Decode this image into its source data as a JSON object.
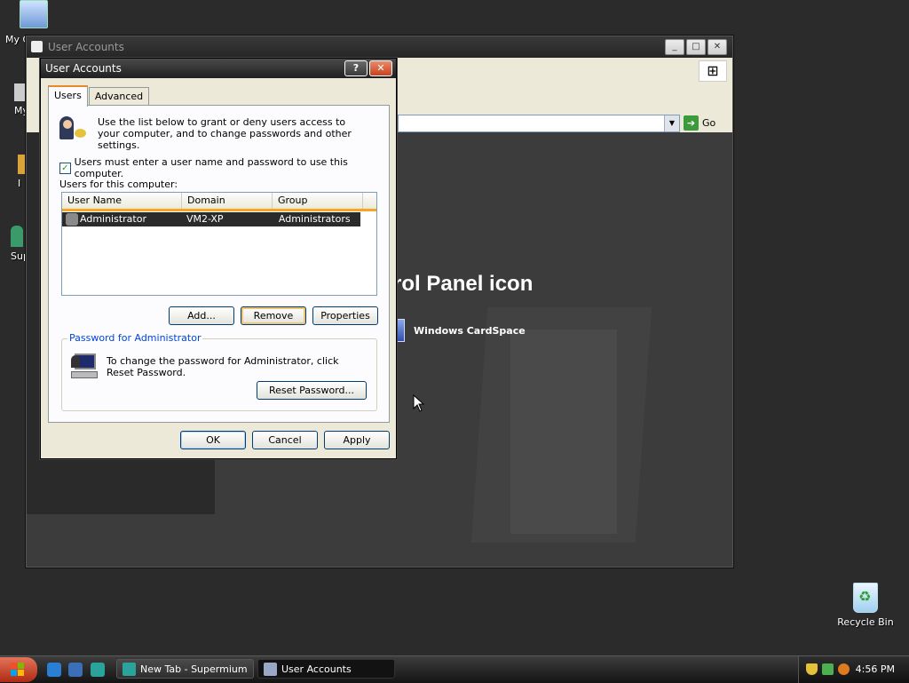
{
  "desktop": {
    "my_computer_label": "My C",
    "stub_labels": [
      "My",
      "I",
      "Sup"
    ],
    "recycle_bin_label": "Recycle Bin"
  },
  "background_window": {
    "title": "User Accounts",
    "go_label": "Go",
    "heading": "rol Panel icon",
    "cardspace_label": "Windows CardSpace",
    "controls": [
      "_",
      "□",
      "✕"
    ]
  },
  "dialog": {
    "title": "User Accounts",
    "help_glyph": "?",
    "close_glyph": "✕",
    "tabs": [
      {
        "label": "Users",
        "active": true
      },
      {
        "label": "Advanced",
        "active": false
      }
    ],
    "intro": "Use the list below to grant or deny users access to your computer, and to change passwords and other settings.",
    "require_login": {
      "label": "Users must enter a user name and password to use this computer.",
      "checked": true,
      "check_glyph": "✓"
    },
    "users_label": "Users for this computer:",
    "columns": [
      "User Name",
      "Domain",
      "Group"
    ],
    "rows": [
      {
        "user": "Administrator",
        "domain": "VM2-XP",
        "group": "Administrators",
        "selected": true
      }
    ],
    "buttons": {
      "add": "Add...",
      "remove": "Remove",
      "properties": "Properties"
    },
    "password_group": {
      "title": "Password for Administrator",
      "text": "To change the password for Administrator, click Reset Password.",
      "reset_button": "Reset Password..."
    },
    "footer": {
      "ok": "OK",
      "cancel": "Cancel",
      "apply": "Apply"
    }
  },
  "taskbar": {
    "tasks": [
      {
        "label": "New Tab - Supermium",
        "active": false
      },
      {
        "label": "User Accounts",
        "active": true
      }
    ],
    "clock": "4:56 PM"
  },
  "colors": {
    "accent_tab": "#e68b2c",
    "list_header_underline": "#f5a623",
    "group_title": "#0046d5",
    "close_button": "#c8421c"
  }
}
